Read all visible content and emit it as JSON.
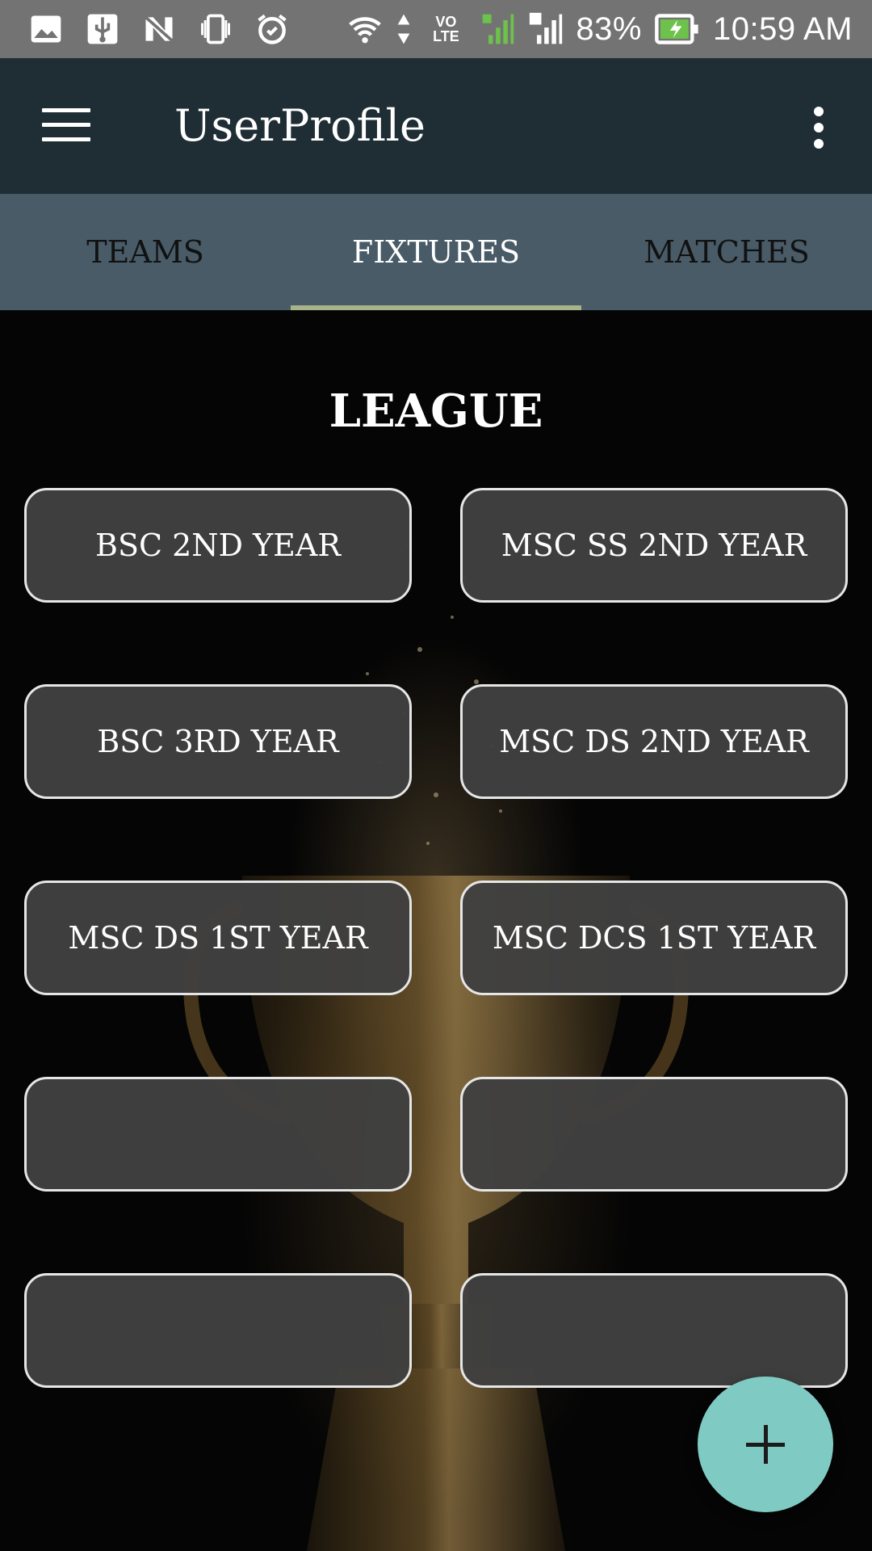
{
  "status_bar": {
    "icons": [
      "image-icon",
      "usb-icon",
      "n-icon",
      "vibrate-icon",
      "alarm-icon",
      "wifi-icon",
      "volte-icon",
      "signal-1-icon",
      "signal-2-icon",
      "battery-charging-icon"
    ],
    "volte_label": "VO LTE",
    "battery": "83%",
    "time": "10:59 AM"
  },
  "app_bar": {
    "title": "UserProfile",
    "menu_icon": "hamburger-menu-icon",
    "overflow_icon": "more-vert-icon"
  },
  "tabs": [
    {
      "label": "TEAMS",
      "active": false
    },
    {
      "label": "FIXTURES",
      "active": true
    },
    {
      "label": "MATCHES",
      "active": false
    }
  ],
  "colors": {
    "status_bar": "#737373",
    "app_bar": "#1f2d35",
    "tab_bar": "#485b67",
    "tab_indicator": "#a7b48a",
    "button_fill": "#404040",
    "fab": "#7fcbc4"
  },
  "content": {
    "heading": "LEAGUE",
    "buttons": [
      "BSC 2ND YEAR",
      "MSC SS 2ND YEAR",
      "BSC 3RD YEAR",
      "MSC DS 2ND YEAR",
      "MSC DS 1ST YEAR",
      "MSC DCS 1ST YEAR",
      "",
      "",
      "",
      ""
    ]
  },
  "fab": {
    "icon": "plus-icon"
  }
}
